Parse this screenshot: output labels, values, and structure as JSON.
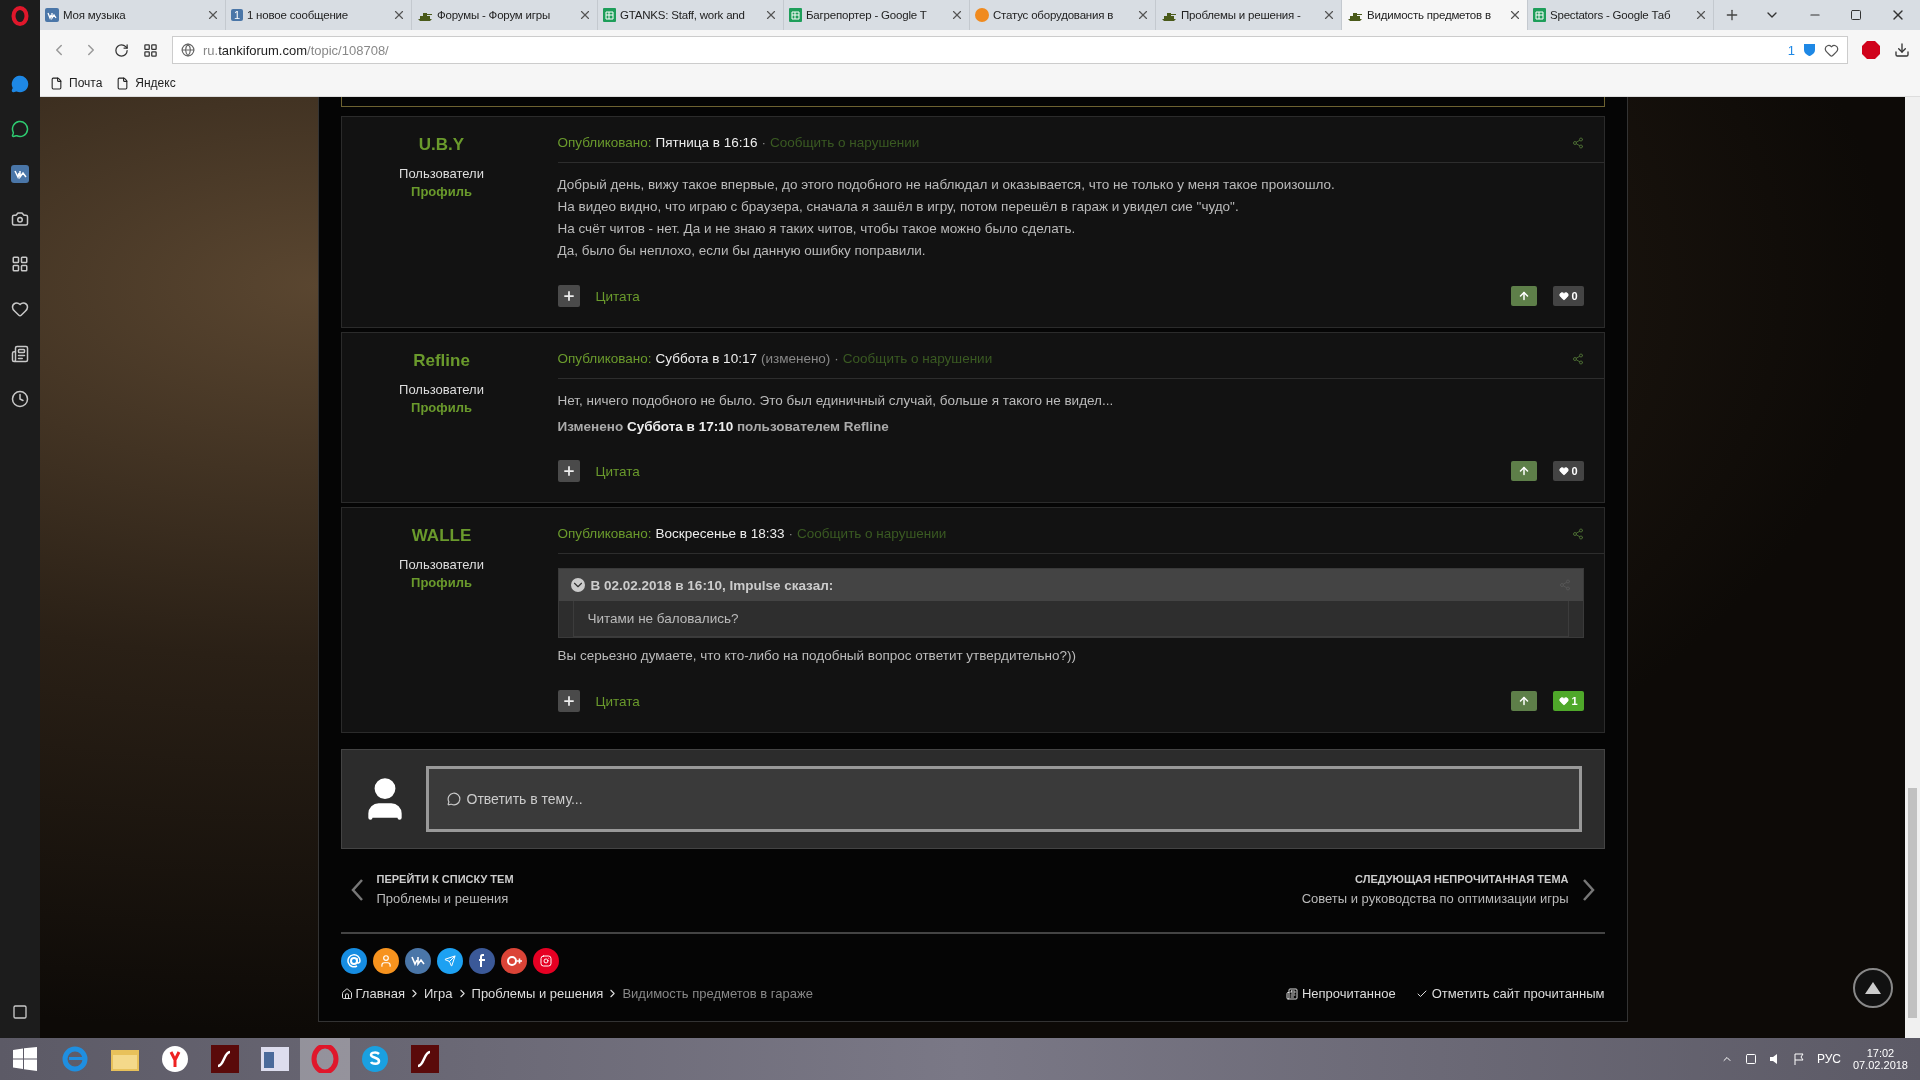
{
  "tabs": [
    {
      "label": "Моя музыка",
      "kind": "vk",
      "selected": false
    },
    {
      "label": "1 новое сообщение",
      "kind": "badge",
      "badge": "1",
      "selected": false
    },
    {
      "label": "Форумы - Форум игры",
      "kind": "tank",
      "selected": false
    },
    {
      "label": "GTANKS: Staff, work and",
      "kind": "sheet",
      "selected": false
    },
    {
      "label": "Багрепортер - Google T",
      "kind": "sheet",
      "selected": false
    },
    {
      "label": "Статус оборудования в",
      "kind": "dns",
      "selected": false
    },
    {
      "label": "Проблемы и решения -",
      "kind": "tank",
      "selected": false
    },
    {
      "label": "Видимость предметов в",
      "kind": "tank",
      "selected": true
    },
    {
      "label": "Spectators - Google Таб",
      "kind": "sheet",
      "selected": false
    }
  ],
  "address": {
    "prefix": "ru.",
    "host": "tankiforum.com",
    "path": "/topic/108708/",
    "blocked_count": "1"
  },
  "bookmarks": [
    "Почта",
    "Яндекс"
  ],
  "posts": [
    {
      "author": "U.B.Y",
      "group": "Пользователи",
      "profile": "Профиль",
      "published_label": "Опубликовано:",
      "date": "Пятница в 16:16",
      "separator": "·",
      "report": "Сообщить о нарушении",
      "paragraphs": [
        "Добрый день, вижу такое впервые, до этого подобного не наблюдал и оказывается, что не только у меня такое произошло.",
        "На видео видно, что играю с браузера, сначала я зашёл в игру, потом перешёл в гараж и увидел сие \"чудо\".",
        "На счёт читов - нет. Да и не знаю я таких читов, чтобы такое можно было сделать.",
        "Да, было бы неплохо, если бы данную ошибку поправили."
      ],
      "quote_label": "Цитата",
      "likes": "0",
      "liked": false
    },
    {
      "author": "Refline",
      "group": "Пользователи",
      "profile": "Профиль",
      "published_label": "Опубликовано:",
      "date": "Суббота в 10:17",
      "edited": "(изменено)",
      "separator": "·",
      "report": "Сообщить о нарушении",
      "paragraphs": [
        "Нет, ничего подобного не было.  Это был единичный случай, больше я такого не видел..."
      ],
      "edit_note": "Изменено **Суббота в 17:10** пользователем Refline",
      "quote_label": "Цитата",
      "likes": "0",
      "liked": false
    },
    {
      "author": "WALLE",
      "group": "Пользователи",
      "profile": "Профиль",
      "published_label": "Опубликовано:",
      "date": "Воскресенье в 18:33",
      "separator": "·",
      "report": "Сообщить о нарушении",
      "quote": {
        "header": "В 02.02.2018 в 16:10, Impulse сказал:",
        "expanded": true,
        "text": "Читами не баловались?"
      },
      "paragraphs": [
        "Вы серьезно думаете, что кто-либо на подобный вопрос ответит утвердительно?))"
      ],
      "quote_label": "Цитата",
      "likes": "1",
      "liked": true
    }
  ],
  "reply": {
    "placeholder": "Ответить в тему..."
  },
  "navigation": {
    "previous": {
      "heading": "ПЕРЕЙТИ К СПИСКУ ТЕМ",
      "title": "Проблемы и решения"
    },
    "next": {
      "heading": "СЛЕДУЮЩАЯ НЕПРОЧИТАННАЯ ТЕМА",
      "title": "Советы и руководства по оптимизации игры"
    }
  },
  "breadcrumb": [
    {
      "label": "Главная",
      "current": false
    },
    {
      "label": "Игра",
      "current": false
    },
    {
      "label": "Проблемы и решения",
      "current": false
    },
    {
      "label": "Видимость предметов в гараже",
      "current": true
    }
  ],
  "footer_links": [
    {
      "label": "Непрочитанное",
      "kind": "unread"
    },
    {
      "label": "Отметить сайт прочитанным",
      "kind": "mark"
    }
  ],
  "taskbar": {
    "apps": [
      {
        "kind": "ie",
        "selected": false
      },
      {
        "kind": "explorer",
        "selected": false
      },
      {
        "kind": "yandex",
        "selected": false
      },
      {
        "kind": "flash",
        "selected": false
      },
      {
        "kind": "window",
        "selected": false
      },
      {
        "kind": "opera",
        "selected": true
      },
      {
        "kind": "skype",
        "selected": false
      },
      {
        "kind": "flash",
        "selected": false
      }
    ],
    "language": "РУС",
    "time": "17:02",
    "date": "07.02.2018"
  }
}
